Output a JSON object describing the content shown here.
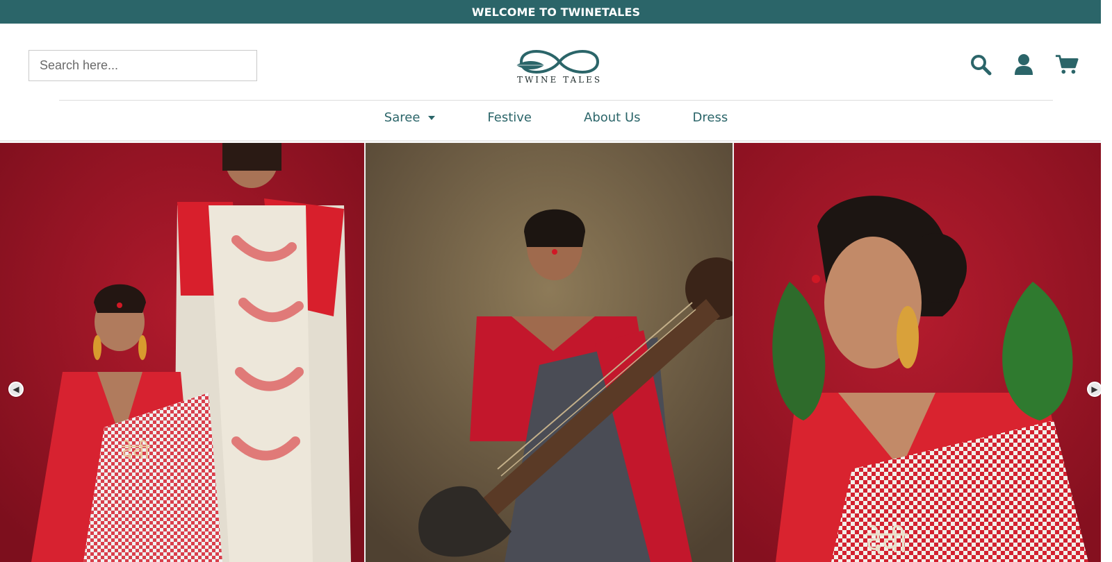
{
  "topbar": {
    "text": "WELCOME TO TWINETALES"
  },
  "header": {
    "search_placeholder": "Search here...",
    "logo_text": "TWINE TALES",
    "icons": [
      "search-icon",
      "user-icon",
      "cart-icon"
    ]
  },
  "nav": {
    "items": [
      {
        "label": "Saree",
        "has_dropdown": true
      },
      {
        "label": "Festive",
        "has_dropdown": false
      },
      {
        "label": "About Us",
        "has_dropdown": false
      },
      {
        "label": "Dress",
        "has_dropdown": false
      }
    ]
  },
  "carousel": {
    "slides": [
      {
        "name": "two women in red and white sarees"
      },
      {
        "name": "woman in red and grey saree with sitar"
      },
      {
        "name": "woman in red saree holding leaves"
      }
    ],
    "devi_text": "देवी"
  },
  "colors": {
    "brand": "#2b6569",
    "topbar_bg": "#2b6569",
    "slide_red": "#9e1527",
    "slide_brown": "#6b5a3e"
  }
}
